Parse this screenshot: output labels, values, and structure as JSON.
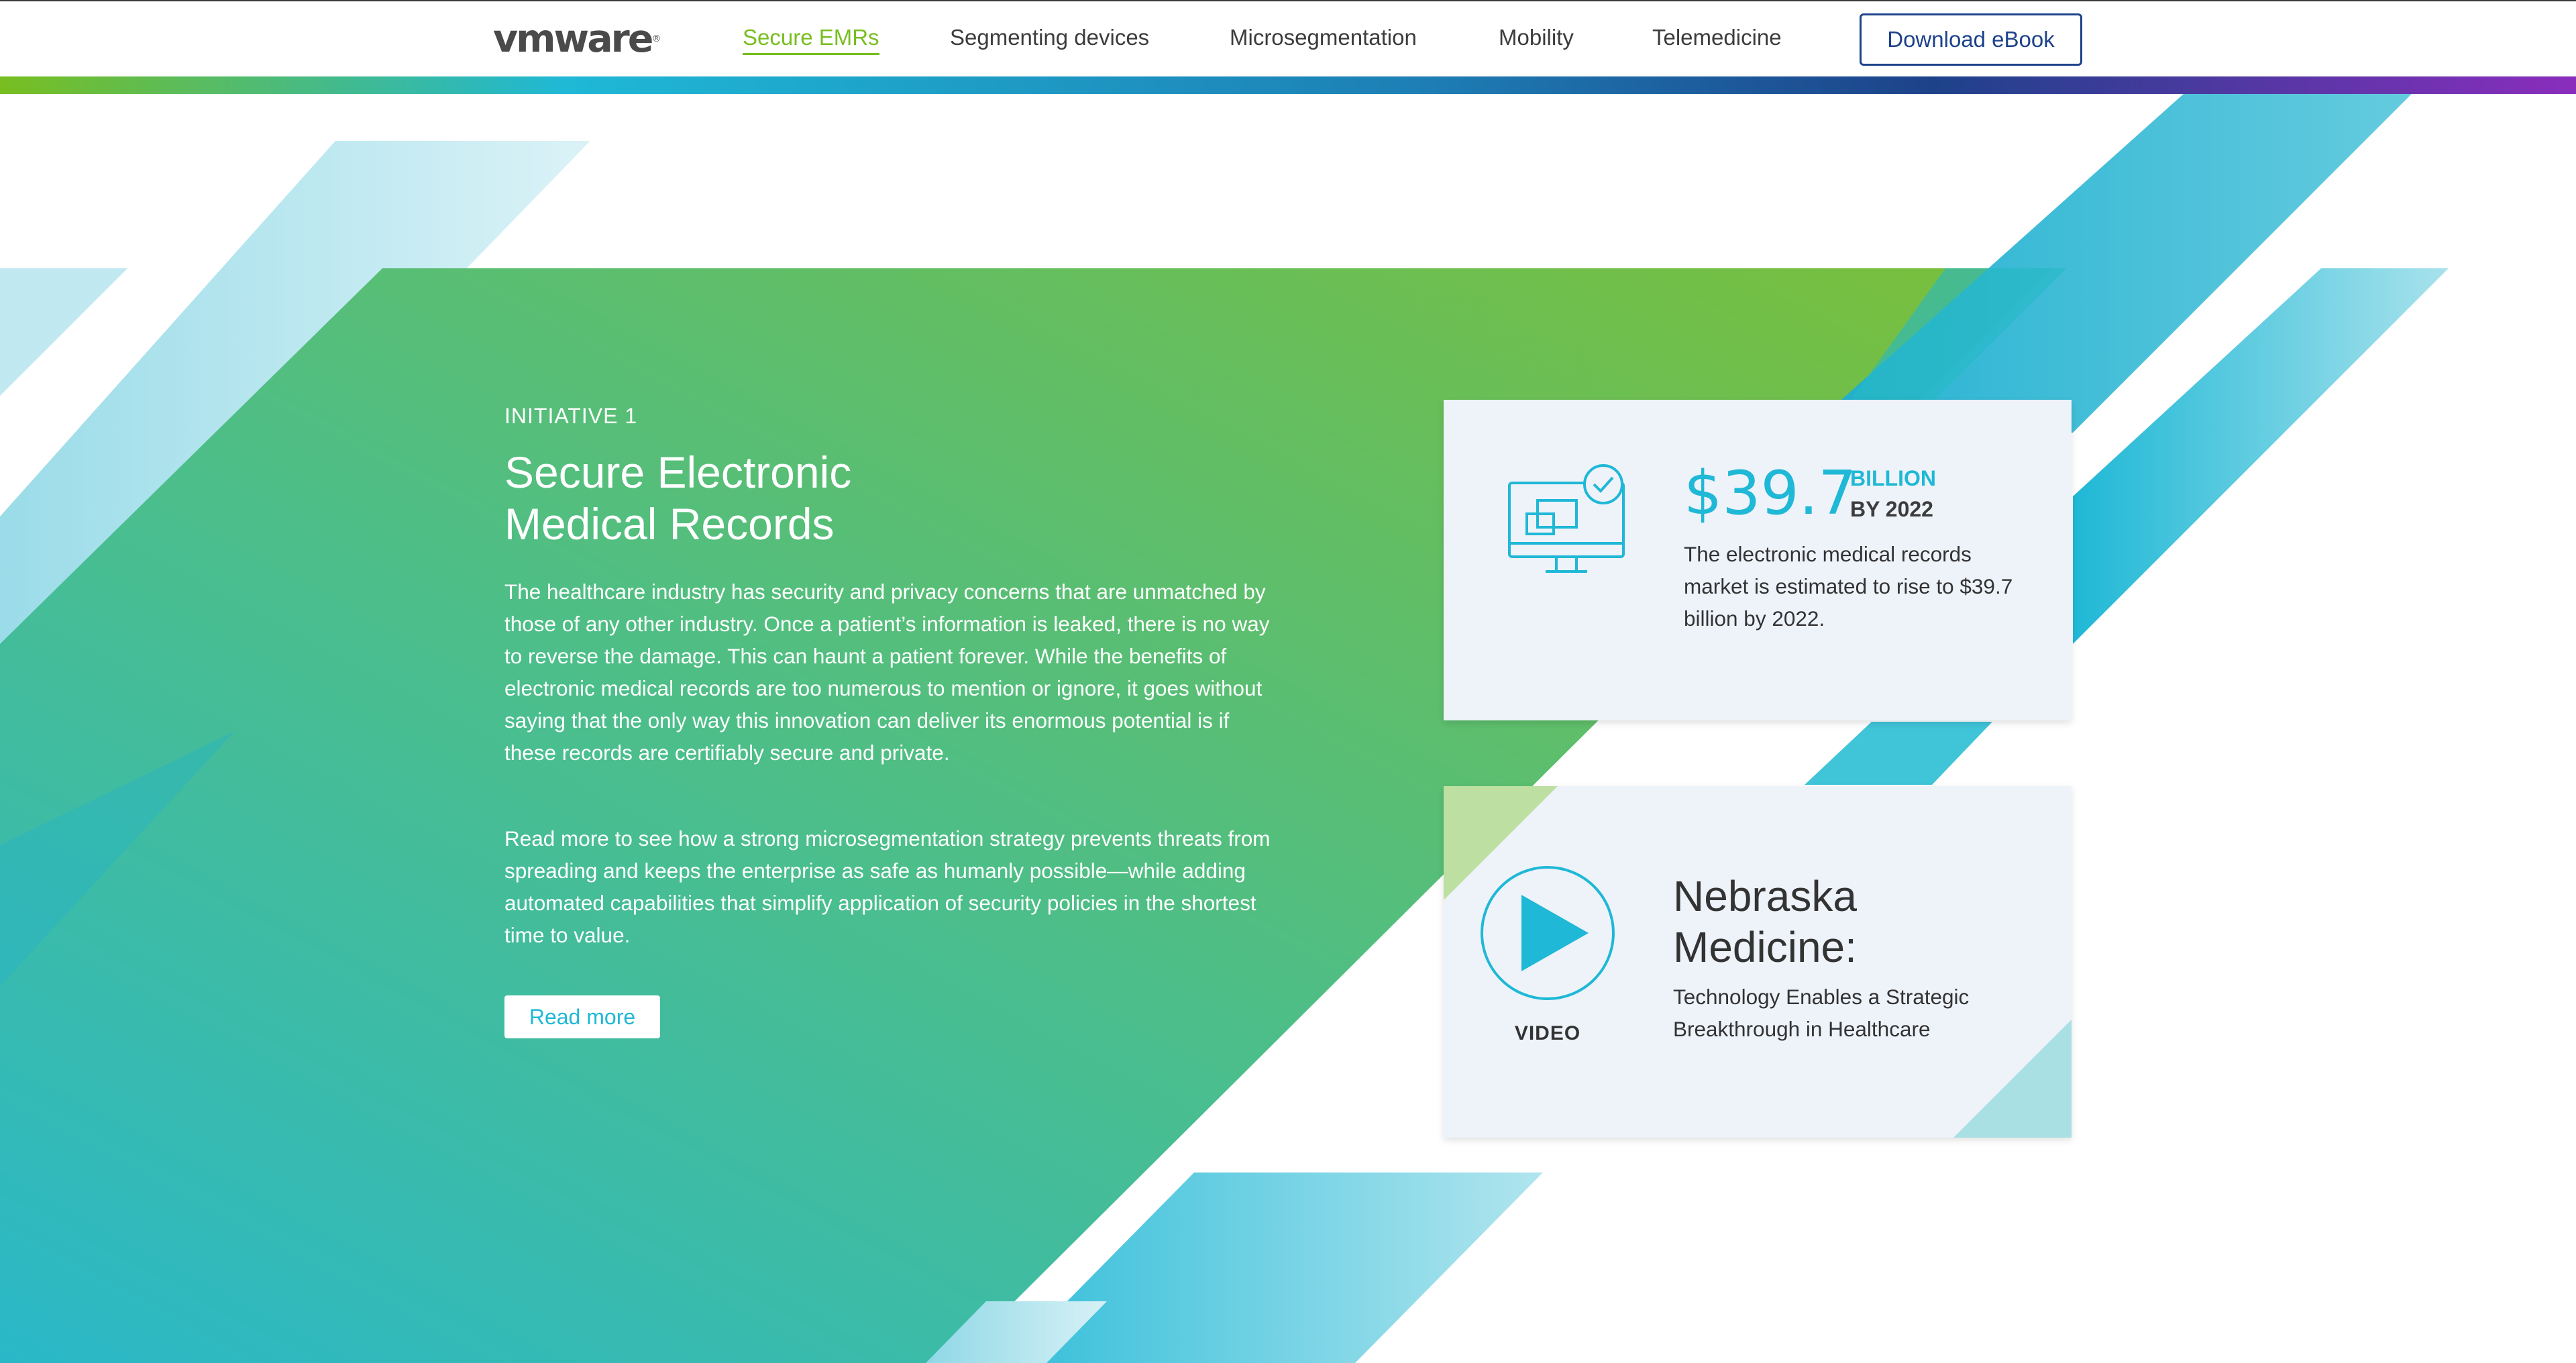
{
  "header": {
    "logo_text": "vmware",
    "logo_mark": "®",
    "nav": [
      {
        "label": "Secure EMRs",
        "active": true
      },
      {
        "label": "Segmenting devices",
        "active": false
      },
      {
        "label": "Microsegmentation",
        "active": false
      },
      {
        "label": "Mobility",
        "active": false
      },
      {
        "label": "Telemedicine",
        "active": false
      }
    ],
    "cta_label": "Download eBook"
  },
  "hero": {
    "eyebrow": "INITIATIVE 1",
    "title_line1": "Secure Electronic",
    "title_line2": "Medical Records",
    "paragraph1": "The healthcare industry has security and privacy concerns that are unmatched by those of any other industry. Once a patient’s information is leaked, there is no way to reverse the damage. This can haunt a patient forever. While the benefits of electronic medical records are too numerous to mention or ignore, it goes without saying that the only way this innovation can deliver its enormous potential is if these records are certifiably secure and private.",
    "paragraph2": "Read more to see how a strong microsegmentation strategy prevents threats from spreading and keeps the enterprise as safe as humanly possible—while adding automated capabilities that simplify application of security policies in the shortest time to value.",
    "read_more_label": "Read more"
  },
  "stat_card": {
    "icon": "monitor-check-icon",
    "value": "$39.7",
    "unit": "BILLION",
    "year": "BY 2022",
    "description": "The electronic medical records market is estimated to rise to $39.7 billion by 2022."
  },
  "video_card": {
    "icon": "play-icon",
    "label": "VIDEO",
    "title_line1": "Nebraska",
    "title_line2": "Medicine:",
    "subtitle": "Technology Enables a Strategic Breakthrough in Healthcare"
  },
  "colors": {
    "accent_green": "#78be20",
    "accent_cyan": "#1fb8d6",
    "brand_navy": "#1d428a",
    "card_bg": "#eef3fa"
  }
}
